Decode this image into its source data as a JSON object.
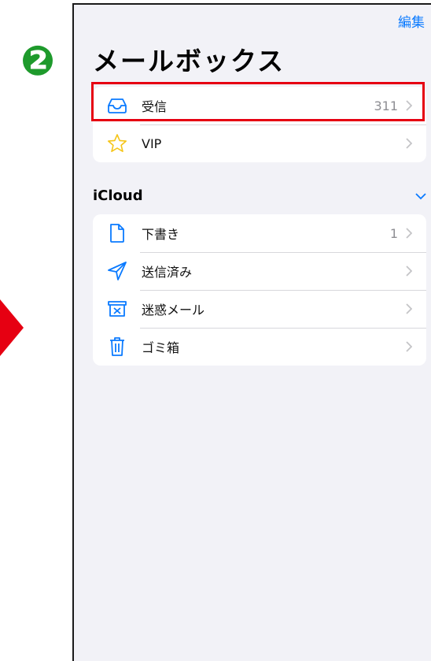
{
  "step_badge": "❷",
  "header": {
    "edit_label": "編集",
    "title": "メールボックス"
  },
  "mailboxes": [
    {
      "label": "受信",
      "count": "311",
      "icon": "inbox-tray-icon"
    },
    {
      "label": "VIP",
      "count": "",
      "icon": "star-icon"
    }
  ],
  "icloud": {
    "title": "iCloud",
    "items": [
      {
        "label": "下書き",
        "count": "1",
        "icon": "document-icon"
      },
      {
        "label": "送信済み",
        "count": "",
        "icon": "paper-plane-icon"
      },
      {
        "label": "迷惑メール",
        "count": "",
        "icon": "junk-box-icon"
      },
      {
        "label": "ゴミ箱",
        "count": "",
        "icon": "trash-icon"
      }
    ]
  },
  "colors": {
    "accent": "#0a7aff",
    "highlight": "#e60012",
    "step": "#1e9a2c",
    "vip_star": "#f5c518"
  }
}
